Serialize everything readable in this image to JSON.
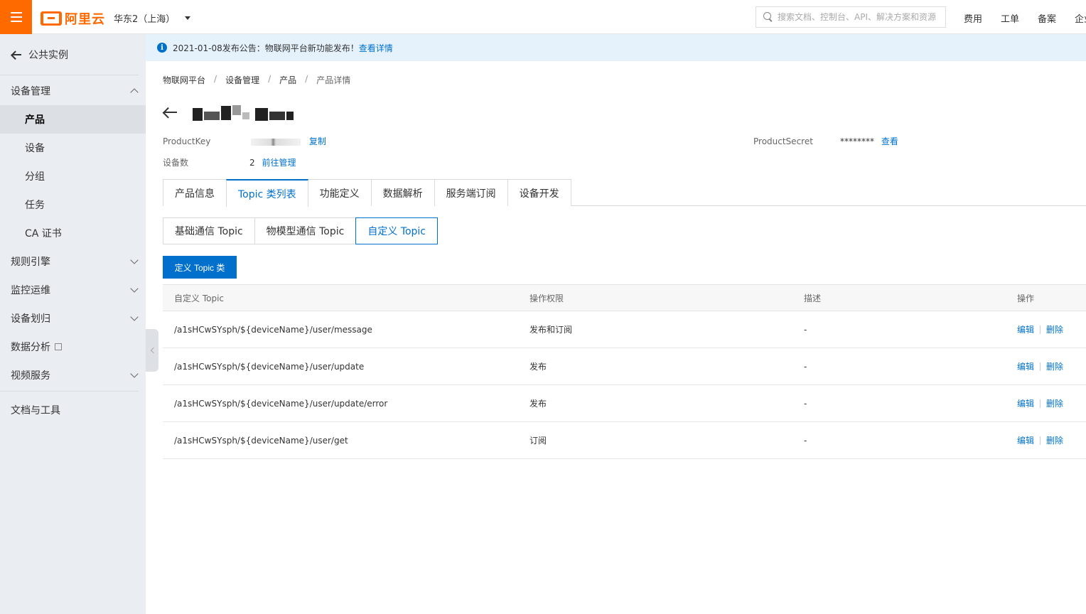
{
  "topbar": {
    "logo_text": "阿里云",
    "region": "华东2（上海）",
    "search_placeholder": "搜索文档、控制台、API、解决方案和资源",
    "nav": [
      "费用",
      "工单",
      "备案",
      "企业"
    ]
  },
  "sidebar": {
    "back_label": "公共实例",
    "groups": [
      {
        "label": "设备管理",
        "expanded": true,
        "items": [
          "产品",
          "设备",
          "分组",
          "任务",
          "CA 证书"
        ],
        "active_item": "产品"
      },
      {
        "label": "规则引擎"
      },
      {
        "label": "监控运维"
      },
      {
        "label": "设备划归"
      },
      {
        "label": "数据分析"
      },
      {
        "label": "视频服务"
      }
    ],
    "footer_label": "文档与工具"
  },
  "notice": {
    "text": "2021-01-08发布公告：物联网平台新功能发布！",
    "link": "查看详情"
  },
  "breadcrumb": [
    "物联网平台",
    "设备管理",
    "产品",
    "产品详情"
  ],
  "product": {
    "productkey_label": "ProductKey",
    "copy_label": "复制",
    "device_count_label": "设备数",
    "device_count": "2",
    "manage_link": "前往管理",
    "productsecret_label": "ProductSecret",
    "productsecret_value": "********",
    "view_label": "查看"
  },
  "tabs": [
    "产品信息",
    "Topic 类列表",
    "功能定义",
    "数据解析",
    "服务端订阅",
    "设备开发"
  ],
  "active_tab": "Topic 类列表",
  "subtabs": [
    "基础通信 Topic",
    "物模型通信 Topic",
    "自定义 Topic"
  ],
  "active_subtab": "自定义 Topic",
  "primary_button": "定义 Topic 类",
  "table": {
    "headers": [
      "自定义 Topic",
      "操作权限",
      "描述",
      "操作"
    ],
    "rows": [
      {
        "topic": "/a1sHCwSYsph/${deviceName}/user/message",
        "permission": "发布和订阅",
        "desc": "-"
      },
      {
        "topic": "/a1sHCwSYsph/${deviceName}/user/update",
        "permission": "发布",
        "desc": "-"
      },
      {
        "topic": "/a1sHCwSYsph/${deviceName}/user/update/error",
        "permission": "发布",
        "desc": "-"
      },
      {
        "topic": "/a1sHCwSYsph/${deviceName}/user/get",
        "permission": "订阅",
        "desc": "-"
      }
    ],
    "edit_label": "编辑",
    "delete_label": "删除"
  },
  "colors": {
    "brand_orange": "#ff6a00",
    "primary_blue": "#0070cc",
    "sidebar_bg": "#eaedf1",
    "notice_bg": "#e5f2fc"
  }
}
